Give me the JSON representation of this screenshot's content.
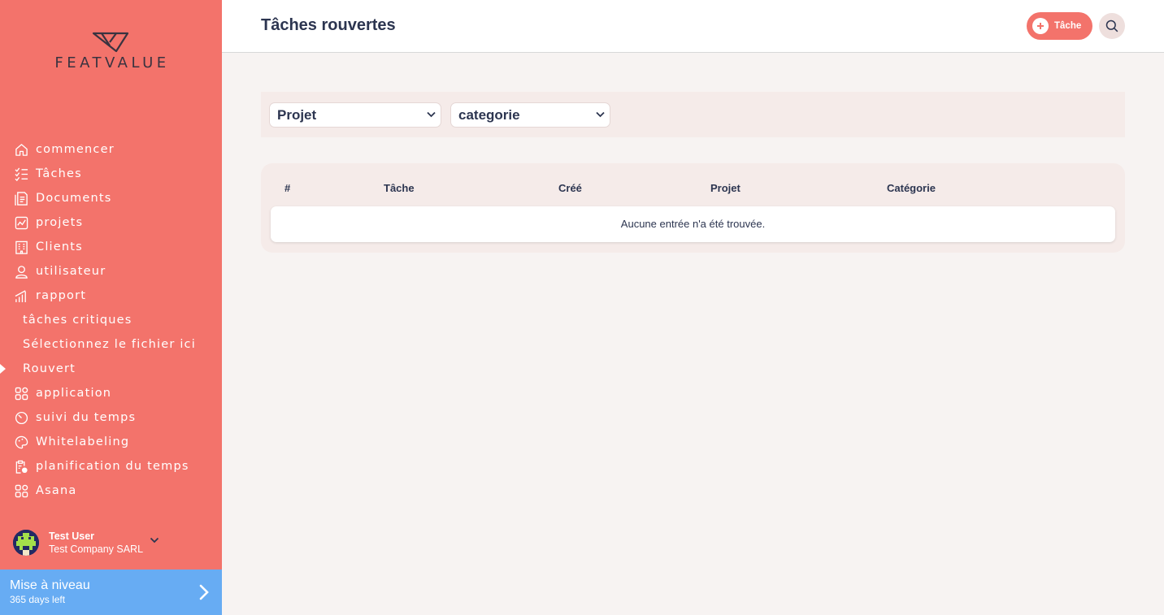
{
  "brand": {
    "name": "FEATVALUE",
    "accent": "#f3736b",
    "upgrade_color": "#67acf3"
  },
  "sidebar": {
    "items": [
      {
        "label": "commencer",
        "icon": "home-icon"
      },
      {
        "label": "Tâches",
        "icon": "checklist-icon"
      },
      {
        "label": "Documents",
        "icon": "document-icon"
      },
      {
        "label": "projets",
        "icon": "chart-icon"
      },
      {
        "label": "Clients",
        "icon": "building-icon"
      },
      {
        "label": "utilisateur",
        "icon": "user-icon"
      },
      {
        "label": "rapport",
        "icon": "bar-chart-icon"
      },
      {
        "label": "tâches critiques",
        "sub": true
      },
      {
        "label": "Sélectionnez le fichier ici",
        "sub": true
      },
      {
        "label": "Rouvert",
        "sub": true,
        "active": true
      },
      {
        "label": "application",
        "icon": "apps-icon"
      },
      {
        "label": "suivi du temps",
        "icon": "timer-icon"
      },
      {
        "label": "Whitelabeling",
        "icon": "palette-icon"
      },
      {
        "label": "planification du temps",
        "icon": "clipboard-clock-icon"
      },
      {
        "label": "Asana",
        "icon": "apps-icon"
      }
    ]
  },
  "user": {
    "name": "Test User",
    "company": "Test Company SARL"
  },
  "upgrade": {
    "title": "Mise à niveau",
    "subtitle": "365 days left"
  },
  "header": {
    "title": "Tâches rouvertes",
    "task_button": "Tâche"
  },
  "filters": {
    "project": "Projet",
    "category": "categorie"
  },
  "table": {
    "columns": [
      "#",
      "Tâche",
      "Créé",
      "Projet",
      "Catégorie"
    ],
    "empty_message": "Aucune entrée n'a été trouvée."
  }
}
